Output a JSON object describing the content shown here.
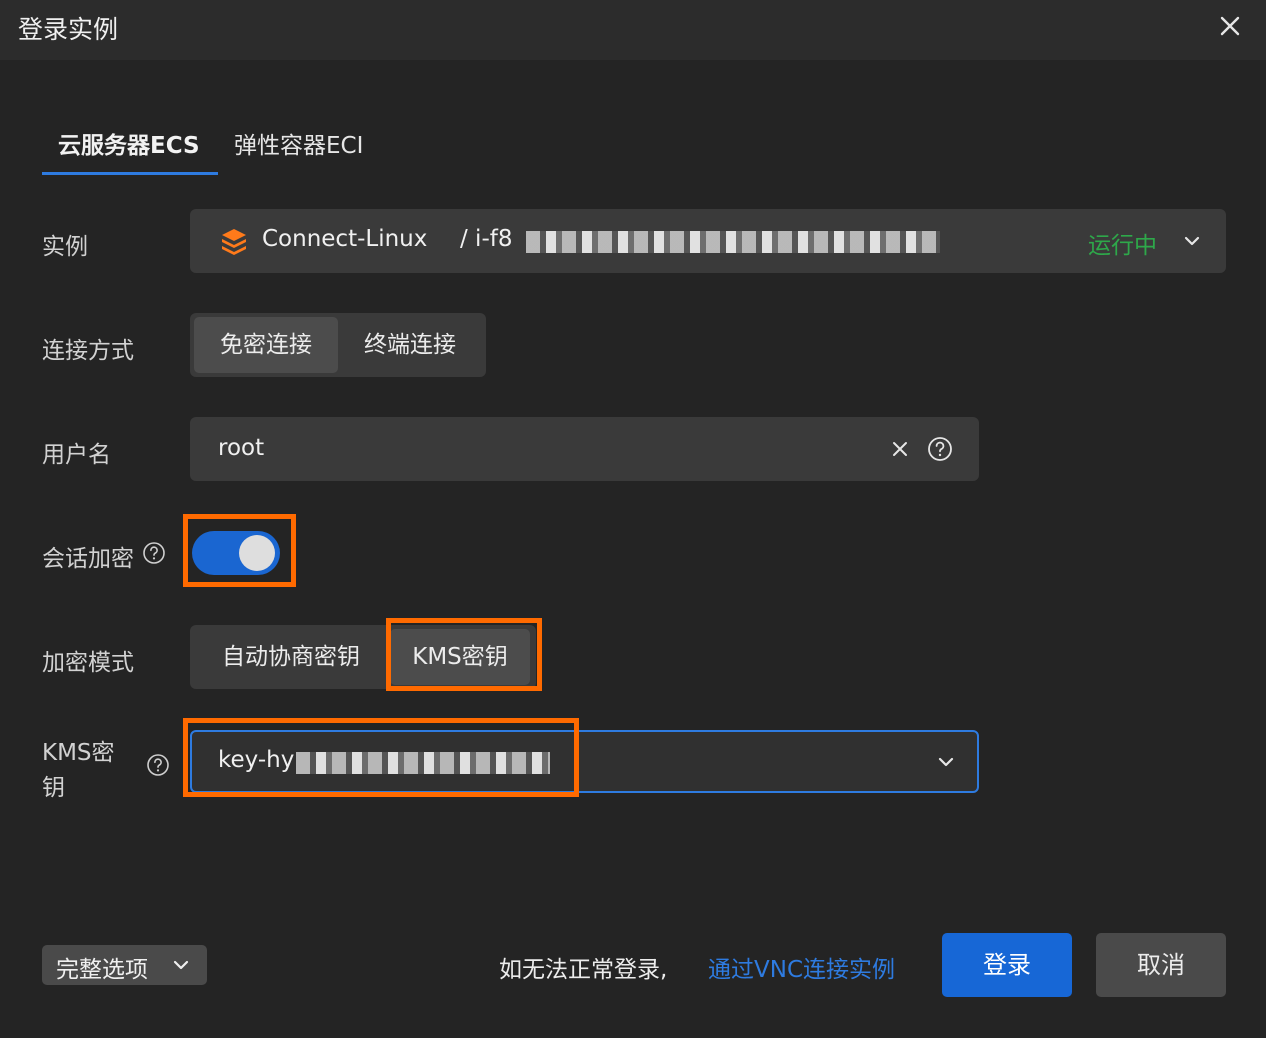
{
  "dialog": {
    "title": "登录实例"
  },
  "tabs": [
    {
      "label": "云服务器ECS",
      "active": true
    },
    {
      "label": "弹性容器ECI",
      "active": false
    }
  ],
  "form": {
    "instance": {
      "label": "实例",
      "name": "Connect-Linux",
      "id_prefix": "/ i-f8",
      "status": "运行中",
      "status_color": "#2ea84a"
    },
    "connection": {
      "label": "连接方式",
      "options": [
        "免密连接",
        "终端连接"
      ],
      "selected": "免密连接"
    },
    "username": {
      "label": "用户名",
      "value": "root"
    },
    "session_encryption": {
      "label": "会话加密",
      "enabled": true
    },
    "encryption_mode": {
      "label": "加密模式",
      "options": [
        "自动协商密钥",
        "KMS密钥"
      ],
      "selected": "KMS密钥"
    },
    "kms_key": {
      "label_line1": "KMS密",
      "label_line2": "钥",
      "value_prefix": "key-hy"
    }
  },
  "footer": {
    "options_button": "完整选项",
    "hint": "如无法正常登录,",
    "vnc_link": "通过VNC连接实例",
    "login_button": "登录",
    "cancel_button": "取消"
  },
  "colors": {
    "accent": "#1767d6",
    "highlight": "#ff6a00"
  }
}
